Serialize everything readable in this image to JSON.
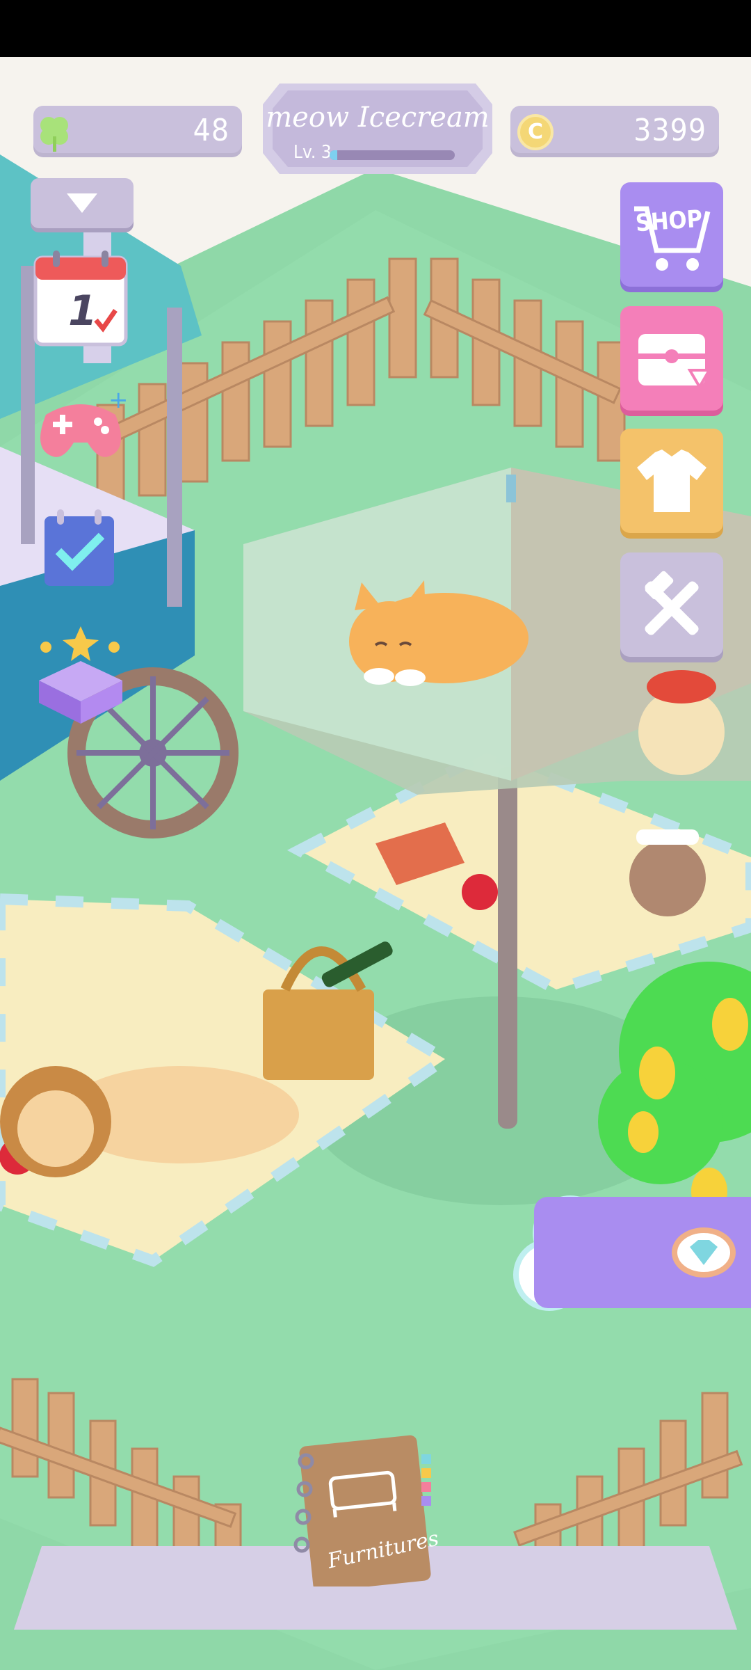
{
  "hud": {
    "clover_count": "48",
    "coins": "3399",
    "coin_symbol": "C",
    "shop_name": "meow Icecream",
    "level_label": "Lv. 3",
    "level_progress": 0.06
  },
  "side_menu": {
    "shop_label": "SHOP",
    "items": [
      "shop-icon",
      "treasure-chest-icon",
      "tshirt-icon",
      "tools-icon"
    ]
  },
  "left_menu": {
    "calendar_day": "1",
    "items": [
      "calendar-icon",
      "gamepad-icon",
      "checklist-icon",
      "mystery-box-icon"
    ]
  },
  "bottom": {
    "furniture_label": "Furnitures"
  },
  "colors": {
    "grass": "#8fd8a8",
    "lavender": "#c9c0dc",
    "shop_purple": "#a98df0",
    "gift_pink": "#f47fb9",
    "shirt_yellow": "#f4c26a"
  }
}
